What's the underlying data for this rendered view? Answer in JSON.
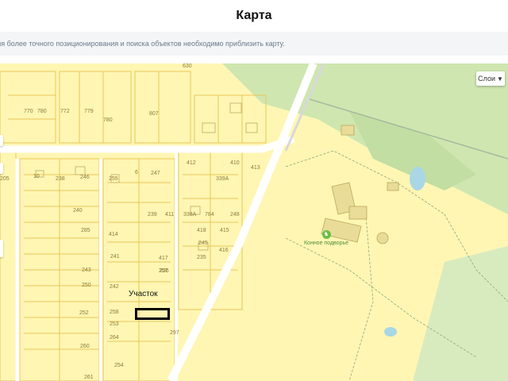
{
  "header": {
    "title": "Карта"
  },
  "notice": {
    "text": "ля более точного позиционирования и поиска объектов необходимо приблизить карту."
  },
  "map": {
    "layers_button": {
      "label": "Слои",
      "icon": "chevron-down-icon"
    },
    "parcel": {
      "label": "Участок"
    },
    "poi": {
      "label": "Конное подворье",
      "icon": "horse-icon"
    },
    "plot_numbers": [
      "630",
      "770",
      "780",
      "772",
      "779",
      "780",
      "807",
      "412",
      "410",
      "413",
      "339А",
      "205",
      "10",
      "238",
      "246",
      "255",
      "6",
      "247",
      "240",
      "239",
      "411",
      "338А",
      "784",
      "248",
      "285",
      "414",
      "418",
      "415",
      "245",
      "241",
      "417",
      "416",
      "235",
      "243",
      "236",
      "250",
      "242",
      "257",
      "258",
      "252",
      "253",
      "260",
      "264",
      "261",
      "254",
      "297"
    ],
    "colors": {
      "land": "#fff6b3",
      "forest": "#cfe6b0",
      "plot_border": "#e8c75a",
      "road": "#ffffff",
      "parcel_outline": "#000000"
    }
  }
}
